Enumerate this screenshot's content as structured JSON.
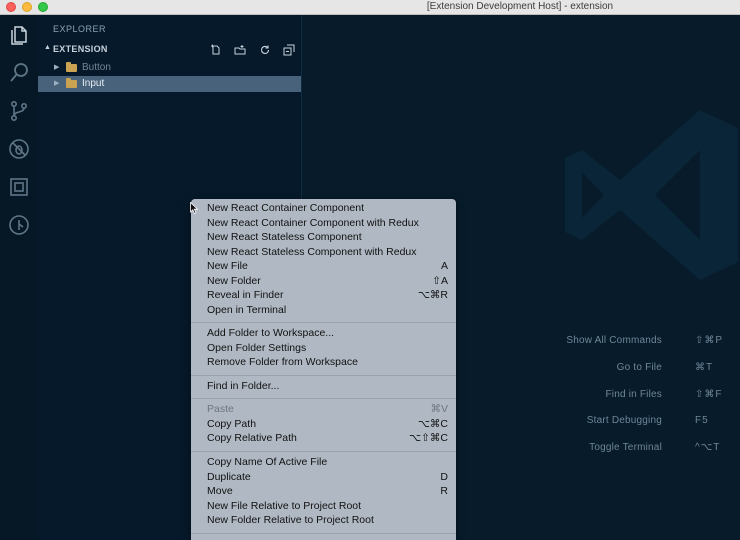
{
  "window": {
    "title": "[Extension Development Host] - extension"
  },
  "activity_bar": {
    "icons": [
      "files-icon",
      "search-icon",
      "source-control-icon",
      "debug-icon",
      "extensions-icon",
      "remote-icon"
    ]
  },
  "sidebar": {
    "title": "EXPLORER",
    "section": "EXTENSION",
    "actions": [
      "new-file-icon",
      "new-folder-icon",
      "refresh-icon",
      "collapse-all-icon"
    ],
    "tree": [
      {
        "name": "Button",
        "selected": false
      },
      {
        "name": "Input",
        "selected": true
      }
    ]
  },
  "editor": {
    "shortcuts": [
      {
        "label": "Show All Commands",
        "key": "⇧⌘P"
      },
      {
        "label": "Go to File",
        "key": "⌘T"
      },
      {
        "label": "Find in Files",
        "key": "⇧⌘F"
      },
      {
        "label": "Start Debugging",
        "key": "F5"
      },
      {
        "label": "Toggle Terminal",
        "key": "^⌥T"
      }
    ]
  },
  "context_menu": {
    "groups": [
      [
        {
          "label": "New React Container Component",
          "key": ""
        },
        {
          "label": "New React Container Component with Redux",
          "key": ""
        },
        {
          "label": "New React Stateless Component",
          "key": ""
        },
        {
          "label": "New React Stateless Component with Redux",
          "key": ""
        },
        {
          "label": "New File",
          "key": "A"
        },
        {
          "label": "New Folder",
          "key": "⇧A"
        },
        {
          "label": "Reveal in Finder",
          "key": "⌥⌘R"
        },
        {
          "label": "Open in Terminal",
          "key": ""
        }
      ],
      [
        {
          "label": "Add Folder to Workspace...",
          "key": ""
        },
        {
          "label": "Open Folder Settings",
          "key": ""
        },
        {
          "label": "Remove Folder from Workspace",
          "key": ""
        }
      ],
      [
        {
          "label": "Find in Folder...",
          "key": ""
        }
      ],
      [
        {
          "label": "Paste",
          "key": "⌘V",
          "disabled": true
        },
        {
          "label": "Copy Path",
          "key": "⌥⌘C"
        },
        {
          "label": "Copy Relative Path",
          "key": "⌥⇧⌘C"
        }
      ],
      [
        {
          "label": "Copy Name Of Active File",
          "key": ""
        },
        {
          "label": "Duplicate",
          "key": "D"
        },
        {
          "label": "Move",
          "key": "R"
        },
        {
          "label": "New File Relative to Project Root",
          "key": ""
        },
        {
          "label": "New Folder Relative to Project Root",
          "key": ""
        }
      ]
    ]
  },
  "colors": {
    "background": "#071b2a",
    "selection": "#48627b",
    "menu_background": "#b0b9c3",
    "folder": "#c9a252"
  }
}
